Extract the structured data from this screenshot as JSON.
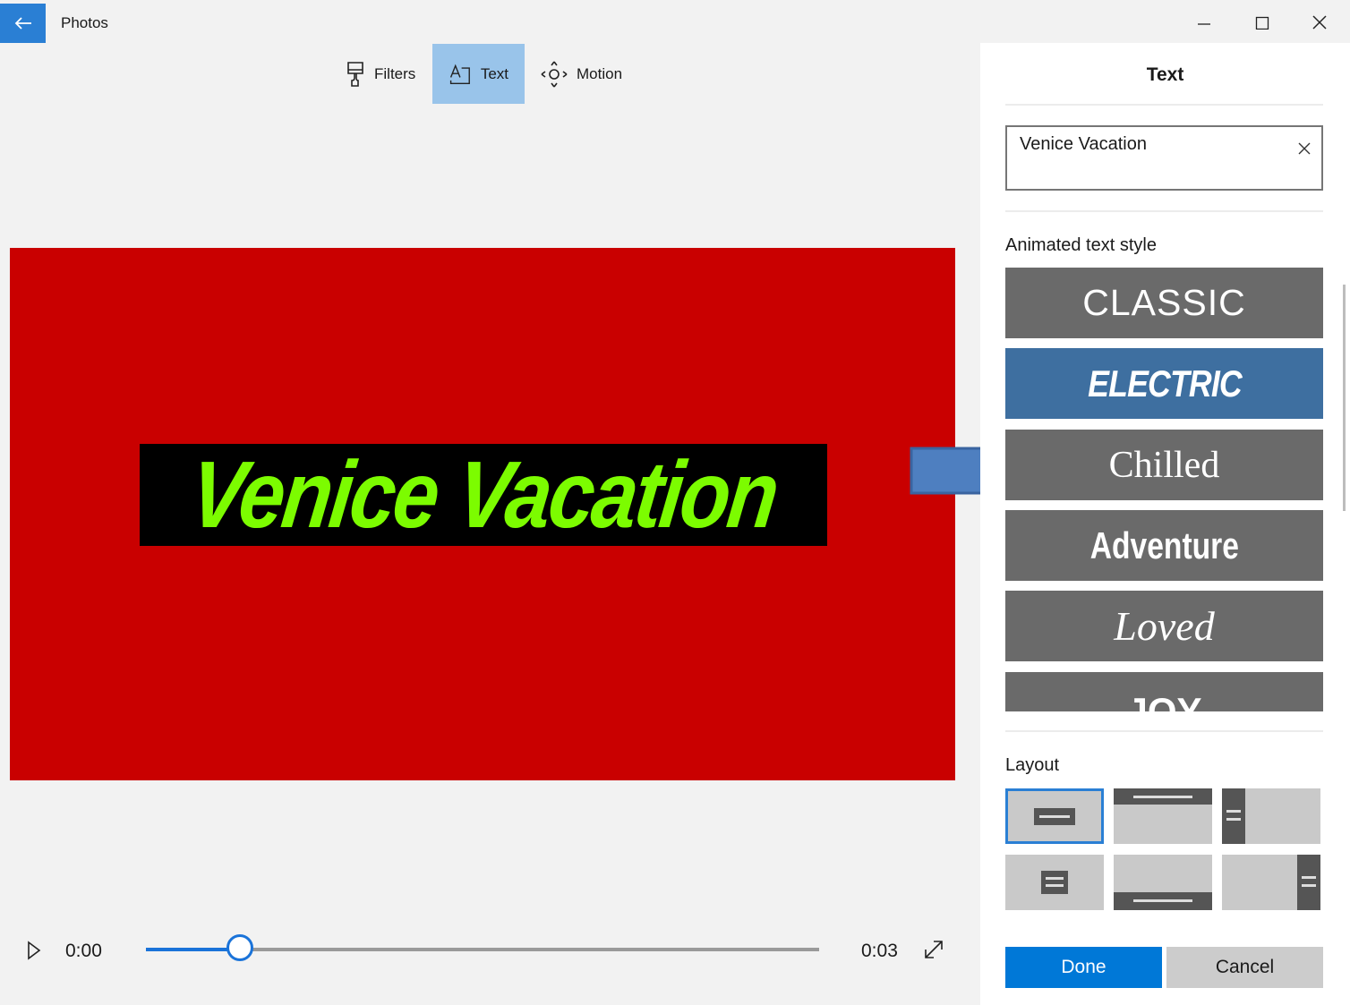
{
  "app": {
    "title": "Photos"
  },
  "window_controls": [
    "minimize-icon",
    "maximize-icon",
    "close-icon"
  ],
  "toolbar": {
    "filters_label": "Filters",
    "text_label": "Text",
    "motion_label": "Motion",
    "active_tool": "Text"
  },
  "preview": {
    "title_text": "Venice Vacation",
    "background_color": "#c90000",
    "text_color": "#7cfc00"
  },
  "player": {
    "current_time": "0:00",
    "end_time": "0:03",
    "progress_fraction": 0.14
  },
  "panel": {
    "title": "Text",
    "text_value": "Venice Vacation",
    "style_label": "Animated text style",
    "styles": [
      {
        "label": "CLASSIC"
      },
      {
        "label": "ELECTRIC",
        "selected": true
      },
      {
        "label": "Chilled"
      },
      {
        "label": "Adventure"
      },
      {
        "label": "Loved"
      },
      {
        "label": "JOY"
      }
    ],
    "layout_label": "Layout",
    "selected_layout": 0,
    "done_label": "Done",
    "cancel_label": "Cancel"
  },
  "colors": {
    "accent": "#0078d7",
    "selected_style": "#3e6fa0",
    "style_tile": "#6a6a6a"
  }
}
